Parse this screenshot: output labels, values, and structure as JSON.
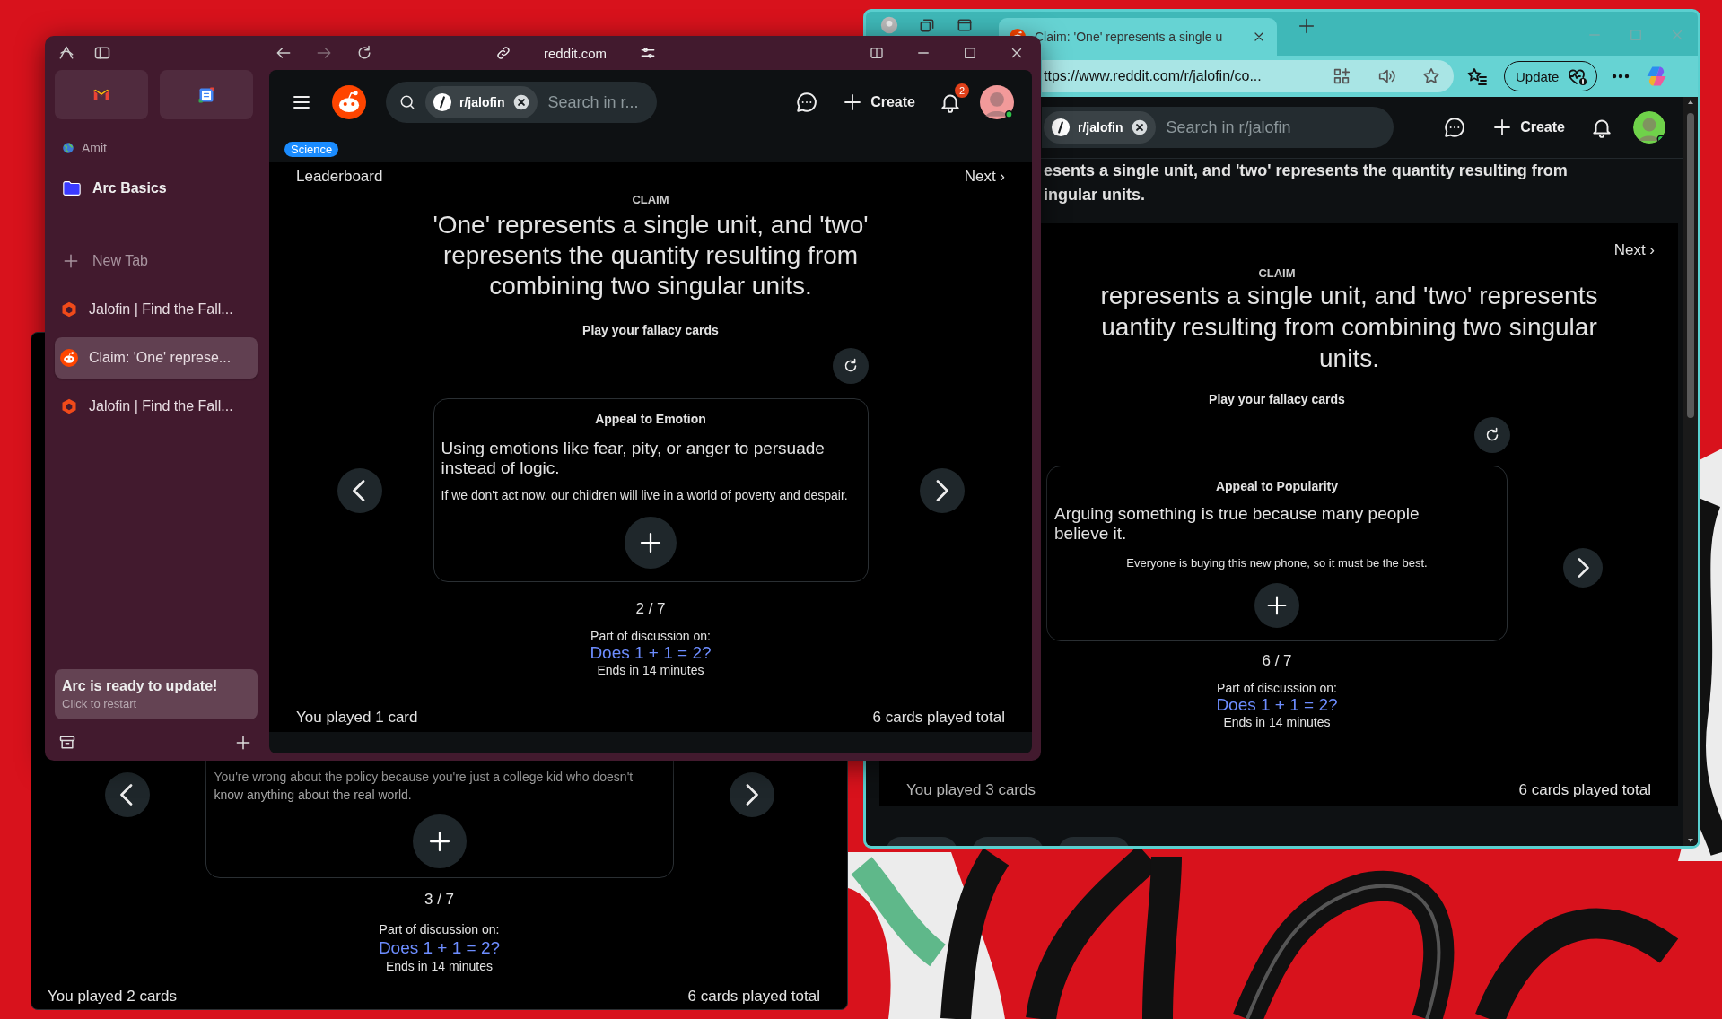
{
  "back_window": {
    "card_example": "You're wrong about the policy because you're just a college kid who doesn't know anything about the real world.",
    "counter": "3 / 7",
    "discussion_label": "Part of discussion on:",
    "discussion_link": "Does 1 + 1 = 2?",
    "ends": "Ends in 14 minutes",
    "you_played": "You played 2 cards",
    "total": "6 cards played total"
  },
  "edge_window": {
    "tabs": [
      {
        "title": "Claim: 'One' represents a single u",
        "selected": true
      }
    ],
    "address": "ttps://www.reddit.com/r/jalofin/co...",
    "update_button": "Update",
    "page": {
      "search_chip": "r/jalofin",
      "search_placeholder": "Search in r/jalofin",
      "create": "Create",
      "heading_lines": [
        "esents a single unit, and 'two' represents the quantity resulting from",
        "ingular units."
      ],
      "next": "Next ›",
      "claim_label": "CLAIM",
      "claim_lines": [
        "represents a single unit, and 'two' represents",
        "uantity resulting from combining two singular",
        "units."
      ],
      "prompt": "Play your fallacy cards",
      "card": {
        "title": "Appeal to Popularity",
        "definition": "Arguing something is true because many people believe it.",
        "example": "Everyone is buying this new phone, so it must be the best."
      },
      "counter": "6 / 7",
      "discussion_label": "Part of discussion on:",
      "discussion_link": "Does 1 + 1 = 2?",
      "ends": "Ends in 14 minutes",
      "you_played": "You played 3 cards",
      "total": "6 cards played total"
    }
  },
  "arc_window": {
    "url": "reddit.com",
    "sidebar": {
      "pinned": [
        {
          "kind": "mail"
        },
        {
          "kind": "calendar"
        }
      ],
      "profile": "Amit",
      "folder": "Arc Basics",
      "new_tab": "New Tab",
      "tabs": [
        {
          "kind": "cube",
          "title": "Jalofin | Find the Fall...",
          "selected": false
        },
        {
          "kind": "alien",
          "title": "Claim: 'One' represe...",
          "selected": true
        },
        {
          "kind": "cube",
          "title": "Jalofin | Find the Fall...",
          "selected": false
        }
      ],
      "update": {
        "title": "Arc is ready to update!",
        "subtitle": "Click to restart"
      }
    },
    "page": {
      "search_chip": "r/jalofin",
      "search_placeholder": "Search in r...",
      "create": "Create",
      "notifications": "2",
      "flair": "Science",
      "leaderboard": "Leaderboard",
      "next": "Next ›",
      "claim_label": "CLAIM",
      "claim": "'One' represents a single unit, and 'two' represents the quantity resulting from combining two singular units.",
      "prompt": "Play your fallacy cards",
      "card": {
        "title": "Appeal to Emotion",
        "definition": "Using emotions like fear, pity, or anger to persuade instead of logic.",
        "example": "If we don't act now, our children will live in a world of poverty and despair."
      },
      "counter": "2 / 7",
      "discussion_label": "Part of discussion on:",
      "discussion_link": "Does 1 + 1 = 2?",
      "ends": "Ends in 14 minutes",
      "you_played": "You played 1 card",
      "total": "6 cards played total"
    }
  }
}
